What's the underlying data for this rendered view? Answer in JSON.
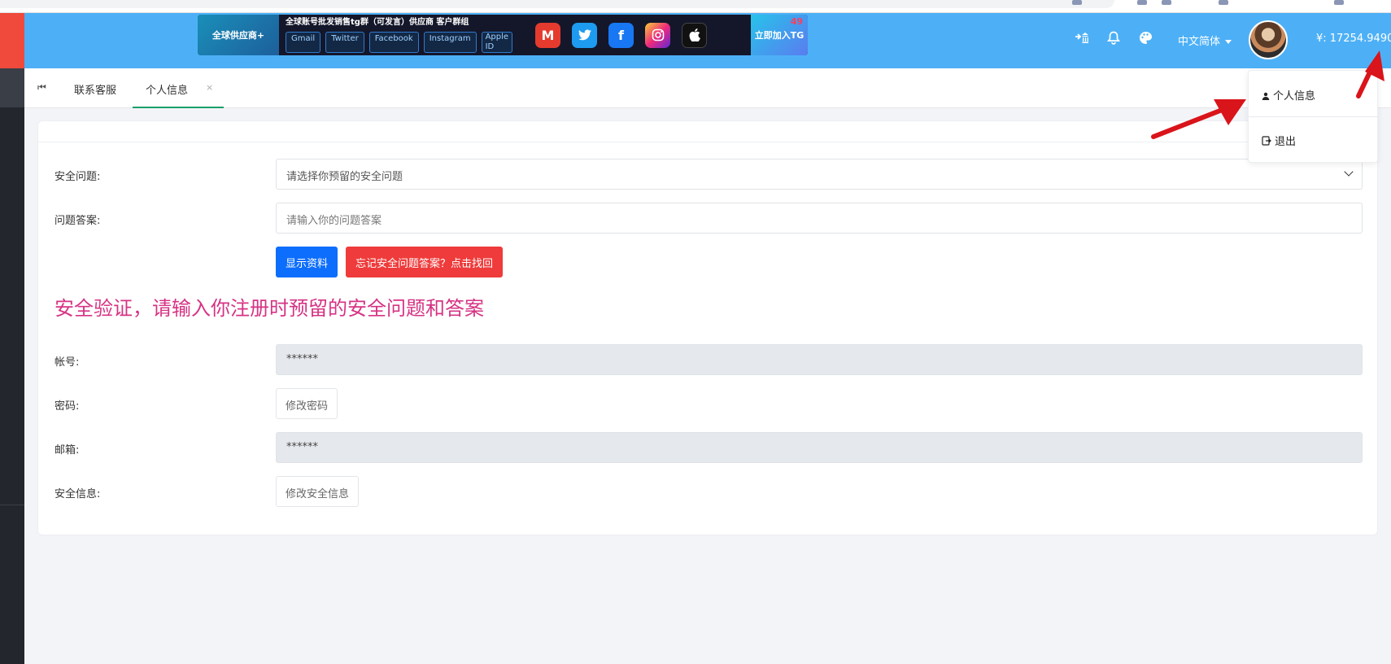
{
  "banner": {
    "left_text": "全球供应商+",
    "title": "全球账号批发销售tg群（可发言）供应商 客户群组",
    "chips": [
      "Gmail",
      "Twitter",
      "Facebook",
      "Instagram",
      "Apple ID"
    ],
    "join_text": "立即加入TG",
    "join_count": "49"
  },
  "header": {
    "language": "中文简体",
    "balance": "¥:  17254.9490"
  },
  "tabs": {
    "first_icon": "⏮",
    "items": [
      "联系客服",
      "个人信息"
    ],
    "close_glyph": "×"
  },
  "form": {
    "security_question_label": "安全问题:",
    "security_question_value": "请选择你预留的安全问题",
    "answer_label": "问题答案:",
    "answer_placeholder": "请输入你的问题答案",
    "show_button": "显示资料",
    "forgot_button": "忘记安全问题答案？点击找回",
    "notice": "安全验证，请输入你注册时预留的安全问题和答案",
    "account_label": "帐号:",
    "account_value": "******",
    "password_label": "密码:",
    "password_button": "修改密码",
    "email_label": "邮箱:",
    "email_value": "******",
    "security_info_label": "安全信息:",
    "security_info_button": "修改安全信息"
  },
  "dropdown": {
    "profile": "个人信息",
    "logout": "退出"
  },
  "colors": {
    "header": "#4db0f6",
    "sidebar": "#23262d",
    "accent_red": "#ef4a3c",
    "primary": "#0d6efd",
    "danger": "#ef3b3b",
    "notice": "#d63384",
    "tab_active": "#1aa06a"
  }
}
